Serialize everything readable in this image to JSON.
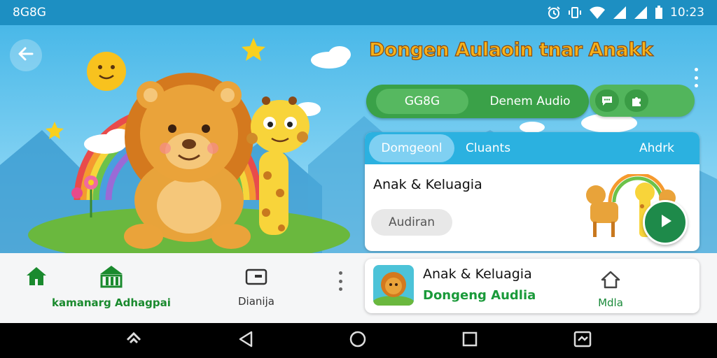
{
  "status_bar": {
    "carrier": "8G8G",
    "time": "10:23",
    "icons": [
      "alarm-icon",
      "vibrate-icon",
      "wifi-icon",
      "signal-icon",
      "signal-icon",
      "battery-icon"
    ]
  },
  "header": {
    "title": "Dongen Aulaoin tnar Anakk",
    "back_icon": "arrow-left-icon",
    "menu_icon": "more-vertical-icon"
  },
  "audio_toggle": {
    "left_label": "GG8G",
    "right_label": "Denem Audio",
    "icon_buttons": [
      "chat-icon",
      "puzzle-icon"
    ]
  },
  "story_card": {
    "tabs": [
      "Domgeonl",
      "Cluants",
      "Ahdrk"
    ],
    "active_tab": 0,
    "title": "Anak & Keluagia",
    "chip": "Audiran",
    "play_icon": "play-icon"
  },
  "bottom_nav": {
    "items": [
      {
        "label": "",
        "icon": "home-icon",
        "color": "#1a8a2e"
      },
      {
        "label": "kamanarg Adhagpai",
        "icon": "building-icon",
        "color": "#1a8a2e"
      },
      {
        "label": "Dianija",
        "icon": "folder-icon",
        "color": "#333333"
      }
    ]
  },
  "list_item": {
    "title": "Anak & Keluagia",
    "subtitle": "Dongeng Audlia",
    "media_label": "Mdla",
    "media_icon": "home-outline-icon"
  },
  "colors": {
    "accent_green": "#3aa148",
    "tab_blue": "#2bb1e0",
    "title_orange": "#f6b21a",
    "status_bar": "#1d8fc2"
  },
  "system_nav": [
    "recents-app-icon",
    "back-triangle-icon",
    "home-circle-icon",
    "overview-square-icon",
    "screenshot-icon"
  ]
}
